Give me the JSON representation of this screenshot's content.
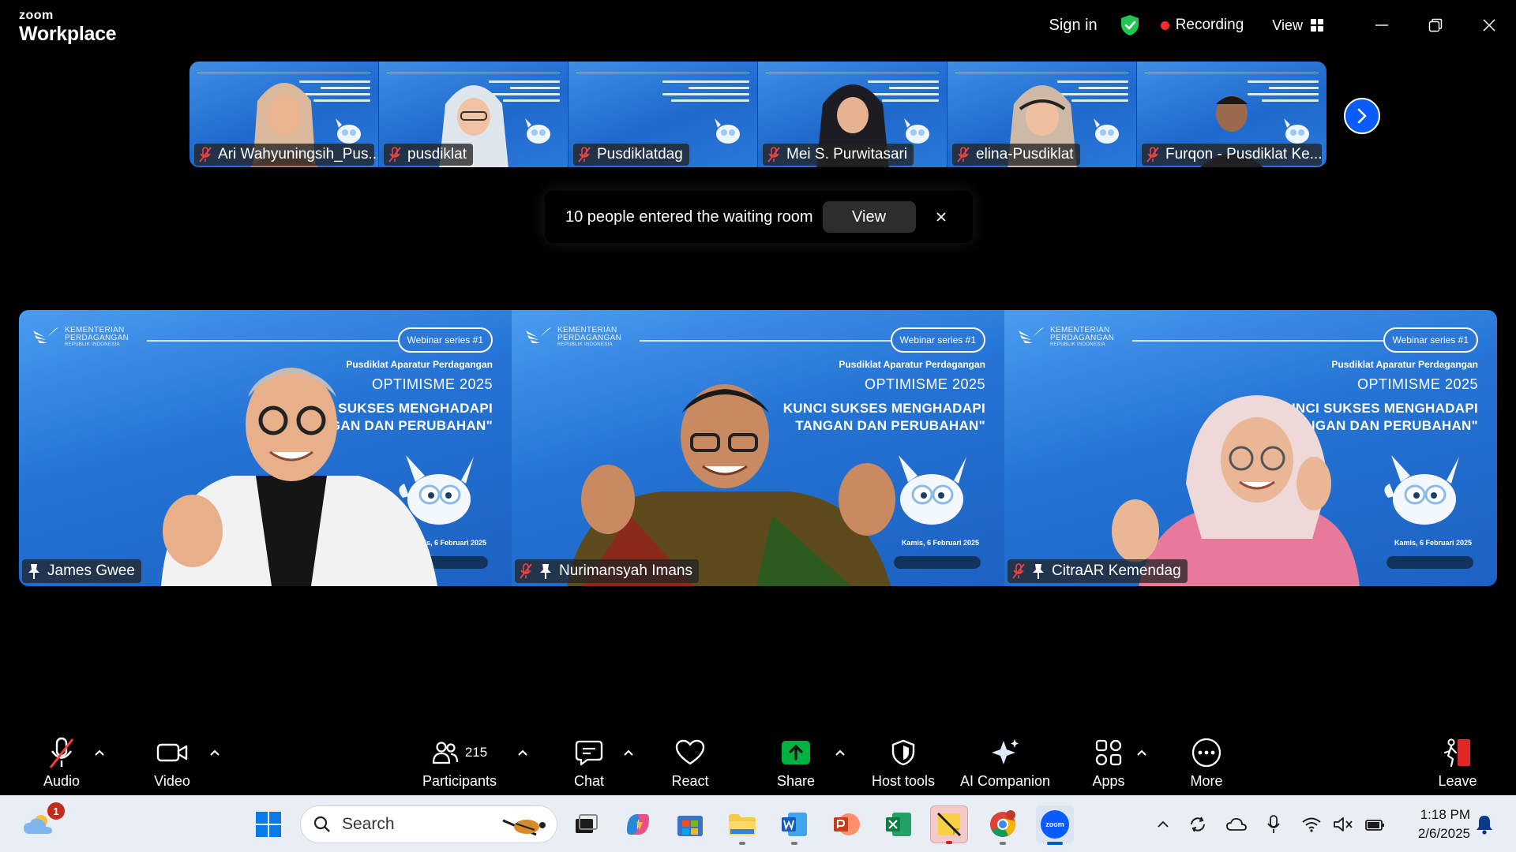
{
  "app": {
    "brand_small": "zoom",
    "brand_large": "Workplace"
  },
  "titlebar": {
    "sign_in": "Sign in",
    "recording": "Recording",
    "view": "View"
  },
  "thumbnails": [
    {
      "name": "Ari Wahyuningsih_Pus..."
    },
    {
      "name": "pusdiklat"
    },
    {
      "name": "Pusdiklatdag"
    },
    {
      "name": "Mei S. Purwitasari"
    },
    {
      "name": "elina-Pusdiklat"
    },
    {
      "name": "Furqon - Pusdiklat Ke..."
    }
  ],
  "waiting_room": {
    "message": "10 people entered the waiting room",
    "view_label": "View",
    "close": "×"
  },
  "banner": {
    "ministry_line1": "KEMENTERIAN",
    "ministry_line2": "PERDAGANGAN",
    "ministry_line3": "REPUBLIK INDONESIA",
    "series": "Webinar series #1",
    "org": "Pusdiklat Aparatur Perdagangan",
    "title": "OPTIMISME 2025",
    "date": "Kamis, 6 Februari 2025"
  },
  "speakers": [
    {
      "name": "James Gwee",
      "tagline1": "I SUKSES MENGHADAPI",
      "tagline2": "GAN DAN PERUBAHAN\""
    },
    {
      "name": "Nurimansyah Imans",
      "tagline1": "KUNCI SUKSES MENGHADAPI",
      "tagline2": "TANGAN DAN PERUBAHAN\""
    },
    {
      "name": "CitraAR Kemendag",
      "tagline1": "\"KUNCI SUKSES MENGHADAPI",
      "tagline2": "NTANGAN DAN PERUBAHAN\""
    }
  ],
  "toolbar": {
    "audio": "Audio",
    "video": "Video",
    "participants": "Participants",
    "participants_count": "215",
    "chat": "Chat",
    "react": "React",
    "share": "Share",
    "host_tools": "Host tools",
    "ai_companion": "AI Companion",
    "apps": "Apps",
    "more": "More",
    "leave": "Leave"
  },
  "taskbar": {
    "search_placeholder": "Search",
    "notification_count": "1",
    "time": "1:18 PM",
    "date": "2/6/2025"
  },
  "colors": {
    "accent": "#0b5cff",
    "share_green": "#00b140",
    "recording_red": "#ff2a2a",
    "banner_blue": "#2473d4"
  }
}
